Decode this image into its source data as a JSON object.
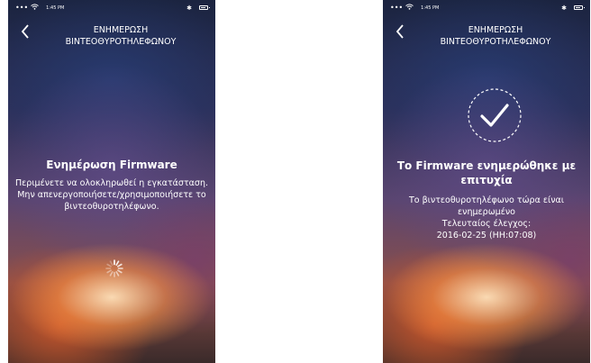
{
  "status_bar": {
    "time": "1:45 PM",
    "signal": "•••"
  },
  "header": {
    "back_label": "<",
    "title_line1": "ΕΝΗΜΕΡΩΣΗ",
    "title_line2": "ΒΙΝΤΕΟΘΥΡΟΤΗΛΕΦΩΝΟΥ"
  },
  "left_screen": {
    "heading": "Ενημέρωση Firmware",
    "message_line1": "Περιμένετε να ολοκληρωθεί η εγκατάσταση.",
    "message_line2": "Μην απενεργοποιήσετε/χρησιμοποιήσετε το",
    "message_line3": "βιντεοθυροτηλέφωνο."
  },
  "right_screen": {
    "heading_line1": "Το Firmware ενημερώθηκε με",
    "heading_line2": "επιτυχία",
    "message_line1": "Το βιντεοθυροτηλέφωνο τώρα είναι",
    "message_line2": "ενημερωμένο",
    "last_check_label": "Τελευταίος έλεγχος:",
    "last_check_value": "2016-02-25 (HH:07:08)"
  },
  "icons": {
    "wifi": "wifi-icon",
    "bluetooth": "bluetooth-icon",
    "battery": "battery-icon",
    "back": "chevron-left-icon",
    "spinner": "loading-spinner-icon",
    "success": "check-circle-icon"
  },
  "colors": {
    "text": "#ffffff",
    "gradient_top": "#1b2440",
    "gradient_glow": "#ff9646"
  }
}
